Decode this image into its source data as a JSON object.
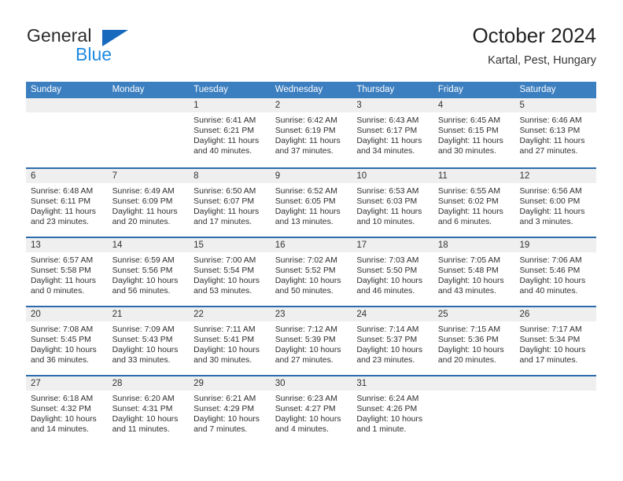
{
  "brand": {
    "name_part1": "General",
    "name_part2": "Blue",
    "logo_icon": "triangle-logo-icon"
  },
  "header": {
    "title": "October 2024",
    "subtitle": "Kartal, Pest, Hungary"
  },
  "calendar": {
    "accent_color": "#3c7fc0",
    "separator_color": "#2c6cad",
    "daynum_band_color": "#efefef",
    "weekdays": [
      "Sunday",
      "Monday",
      "Tuesday",
      "Wednesday",
      "Thursday",
      "Friday",
      "Saturday"
    ],
    "weeks": [
      [
        {
          "day": "",
          "lines": []
        },
        {
          "day": "",
          "lines": []
        },
        {
          "day": "1",
          "lines": [
            "Sunrise: 6:41 AM",
            "Sunset: 6:21 PM",
            "Daylight: 11 hours",
            "and 40 minutes."
          ]
        },
        {
          "day": "2",
          "lines": [
            "Sunrise: 6:42 AM",
            "Sunset: 6:19 PM",
            "Daylight: 11 hours",
            "and 37 minutes."
          ]
        },
        {
          "day": "3",
          "lines": [
            "Sunrise: 6:43 AM",
            "Sunset: 6:17 PM",
            "Daylight: 11 hours",
            "and 34 minutes."
          ]
        },
        {
          "day": "4",
          "lines": [
            "Sunrise: 6:45 AM",
            "Sunset: 6:15 PM",
            "Daylight: 11 hours",
            "and 30 minutes."
          ]
        },
        {
          "day": "5",
          "lines": [
            "Sunrise: 6:46 AM",
            "Sunset: 6:13 PM",
            "Daylight: 11 hours",
            "and 27 minutes."
          ]
        }
      ],
      [
        {
          "day": "6",
          "lines": [
            "Sunrise: 6:48 AM",
            "Sunset: 6:11 PM",
            "Daylight: 11 hours",
            "and 23 minutes."
          ]
        },
        {
          "day": "7",
          "lines": [
            "Sunrise: 6:49 AM",
            "Sunset: 6:09 PM",
            "Daylight: 11 hours",
            "and 20 minutes."
          ]
        },
        {
          "day": "8",
          "lines": [
            "Sunrise: 6:50 AM",
            "Sunset: 6:07 PM",
            "Daylight: 11 hours",
            "and 17 minutes."
          ]
        },
        {
          "day": "9",
          "lines": [
            "Sunrise: 6:52 AM",
            "Sunset: 6:05 PM",
            "Daylight: 11 hours",
            "and 13 minutes."
          ]
        },
        {
          "day": "10",
          "lines": [
            "Sunrise: 6:53 AM",
            "Sunset: 6:03 PM",
            "Daylight: 11 hours",
            "and 10 minutes."
          ]
        },
        {
          "day": "11",
          "lines": [
            "Sunrise: 6:55 AM",
            "Sunset: 6:02 PM",
            "Daylight: 11 hours",
            "and 6 minutes."
          ]
        },
        {
          "day": "12",
          "lines": [
            "Sunrise: 6:56 AM",
            "Sunset: 6:00 PM",
            "Daylight: 11 hours",
            "and 3 minutes."
          ]
        }
      ],
      [
        {
          "day": "13",
          "lines": [
            "Sunrise: 6:57 AM",
            "Sunset: 5:58 PM",
            "Daylight: 11 hours",
            "and 0 minutes."
          ]
        },
        {
          "day": "14",
          "lines": [
            "Sunrise: 6:59 AM",
            "Sunset: 5:56 PM",
            "Daylight: 10 hours",
            "and 56 minutes."
          ]
        },
        {
          "day": "15",
          "lines": [
            "Sunrise: 7:00 AM",
            "Sunset: 5:54 PM",
            "Daylight: 10 hours",
            "and 53 minutes."
          ]
        },
        {
          "day": "16",
          "lines": [
            "Sunrise: 7:02 AM",
            "Sunset: 5:52 PM",
            "Daylight: 10 hours",
            "and 50 minutes."
          ]
        },
        {
          "day": "17",
          "lines": [
            "Sunrise: 7:03 AM",
            "Sunset: 5:50 PM",
            "Daylight: 10 hours",
            "and 46 minutes."
          ]
        },
        {
          "day": "18",
          "lines": [
            "Sunrise: 7:05 AM",
            "Sunset: 5:48 PM",
            "Daylight: 10 hours",
            "and 43 minutes."
          ]
        },
        {
          "day": "19",
          "lines": [
            "Sunrise: 7:06 AM",
            "Sunset: 5:46 PM",
            "Daylight: 10 hours",
            "and 40 minutes."
          ]
        }
      ],
      [
        {
          "day": "20",
          "lines": [
            "Sunrise: 7:08 AM",
            "Sunset: 5:45 PM",
            "Daylight: 10 hours",
            "and 36 minutes."
          ]
        },
        {
          "day": "21",
          "lines": [
            "Sunrise: 7:09 AM",
            "Sunset: 5:43 PM",
            "Daylight: 10 hours",
            "and 33 minutes."
          ]
        },
        {
          "day": "22",
          "lines": [
            "Sunrise: 7:11 AM",
            "Sunset: 5:41 PM",
            "Daylight: 10 hours",
            "and 30 minutes."
          ]
        },
        {
          "day": "23",
          "lines": [
            "Sunrise: 7:12 AM",
            "Sunset: 5:39 PM",
            "Daylight: 10 hours",
            "and 27 minutes."
          ]
        },
        {
          "day": "24",
          "lines": [
            "Sunrise: 7:14 AM",
            "Sunset: 5:37 PM",
            "Daylight: 10 hours",
            "and 23 minutes."
          ]
        },
        {
          "day": "25",
          "lines": [
            "Sunrise: 7:15 AM",
            "Sunset: 5:36 PM",
            "Daylight: 10 hours",
            "and 20 minutes."
          ]
        },
        {
          "day": "26",
          "lines": [
            "Sunrise: 7:17 AM",
            "Sunset: 5:34 PM",
            "Daylight: 10 hours",
            "and 17 minutes."
          ]
        }
      ],
      [
        {
          "day": "27",
          "lines": [
            "Sunrise: 6:18 AM",
            "Sunset: 4:32 PM",
            "Daylight: 10 hours",
            "and 14 minutes."
          ]
        },
        {
          "day": "28",
          "lines": [
            "Sunrise: 6:20 AM",
            "Sunset: 4:31 PM",
            "Daylight: 10 hours",
            "and 11 minutes."
          ]
        },
        {
          "day": "29",
          "lines": [
            "Sunrise: 6:21 AM",
            "Sunset: 4:29 PM",
            "Daylight: 10 hours",
            "and 7 minutes."
          ]
        },
        {
          "day": "30",
          "lines": [
            "Sunrise: 6:23 AM",
            "Sunset: 4:27 PM",
            "Daylight: 10 hours",
            "and 4 minutes."
          ]
        },
        {
          "day": "31",
          "lines": [
            "Sunrise: 6:24 AM",
            "Sunset: 4:26 PM",
            "Daylight: 10 hours",
            "and 1 minute."
          ]
        },
        {
          "day": "",
          "lines": []
        },
        {
          "day": "",
          "lines": []
        }
      ]
    ]
  }
}
